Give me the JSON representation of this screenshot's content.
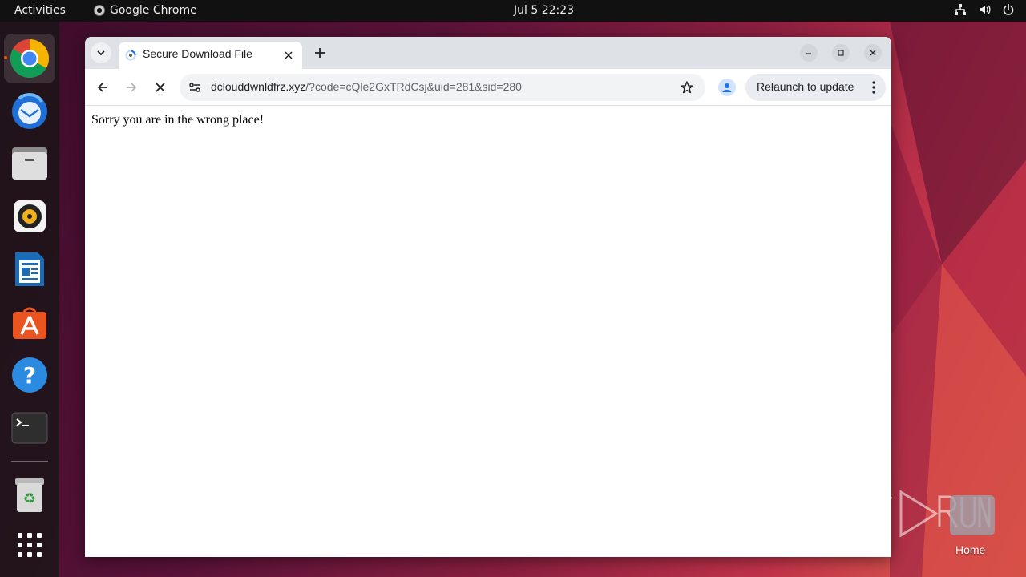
{
  "topbar": {
    "activities": "Activities",
    "app_name": "Google Chrome",
    "clock": "Jul 5  22:23",
    "tray_icons": [
      "network-icon",
      "volume-icon",
      "power-icon"
    ]
  },
  "dock": {
    "items": [
      {
        "name": "chrome",
        "icon": "chrome-icon",
        "active": true
      },
      {
        "name": "thunderbird",
        "icon": "thunderbird-icon",
        "active": false
      },
      {
        "name": "files",
        "icon": "files-icon",
        "active": false
      },
      {
        "name": "rhythmbox",
        "icon": "rhythmbox-icon",
        "active": false
      },
      {
        "name": "writer",
        "icon": "libreoffice-writer-icon",
        "active": false
      },
      {
        "name": "app-center",
        "icon": "app-center-icon",
        "active": false
      },
      {
        "name": "help",
        "icon": "help-icon",
        "active": false
      },
      {
        "name": "terminal",
        "icon": "terminal-icon",
        "active": false
      },
      {
        "name": "trash",
        "icon": "trash-icon",
        "active": false
      },
      {
        "name": "show-apps",
        "icon": "app-grid-icon",
        "active": false
      }
    ]
  },
  "browser": {
    "tab": {
      "title": "Secure Download File",
      "favicon": "loading-favicon-icon"
    },
    "omnibox": {
      "host": "dclouddwnldfrz.xyz",
      "path": "/?code=cQle2GxTRdCsj&uid=281&sid=280"
    },
    "relaunch_label": "Relaunch to update",
    "page": {
      "message": "Sorry you are in the wrong place!"
    }
  },
  "desktop": {
    "home_label": "Home",
    "watermark": "ANY RUN"
  },
  "colors": {
    "ubuntu_orange": "#e95420",
    "tabstrip": "#dee1e6",
    "omnibox": "#f1f3f4"
  }
}
